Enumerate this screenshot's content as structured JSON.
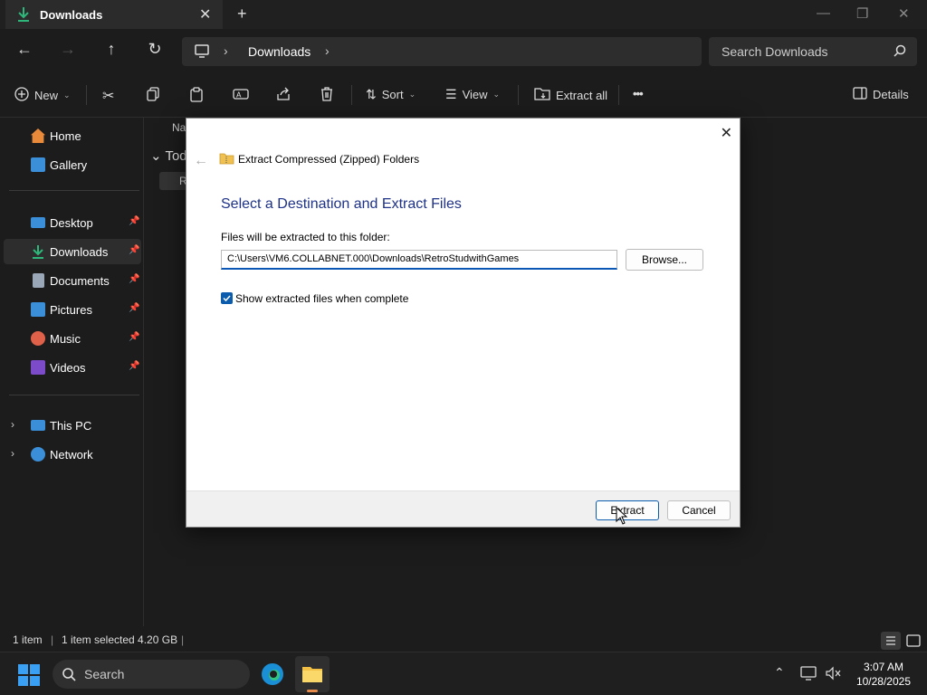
{
  "window": {
    "tab_title": "Downloads",
    "tab_close": "✕",
    "new_tab": "+"
  },
  "address": {
    "crumb": "Downloads",
    "separator": "›",
    "search_placeholder": "Search Downloads"
  },
  "commandbar": {
    "new_label": "New",
    "sort_label": "Sort",
    "view_label": "View",
    "extract_all_label": "Extract all",
    "more_label": "•••",
    "details_label": "Details"
  },
  "sidebar": {
    "items": [
      {
        "label": "Home",
        "icon": "home-icon",
        "color": "#e88a3a"
      },
      {
        "label": "Gallery",
        "icon": "gallery-icon",
        "color": "#3b8fd8"
      },
      {
        "label": "Desktop",
        "icon": "desktop-icon",
        "color": "#3b8fd8",
        "pinned": true
      },
      {
        "label": "Downloads",
        "icon": "download-icon",
        "color": "#2fb67a",
        "pinned": true,
        "selected": true
      },
      {
        "label": "Documents",
        "icon": "documents-icon",
        "color": "#9aa7b8",
        "pinned": true
      },
      {
        "label": "Pictures",
        "icon": "pictures-icon",
        "color": "#3b8fd8",
        "pinned": true
      },
      {
        "label": "Music",
        "icon": "music-icon",
        "color": "#e0614a",
        "pinned": true
      },
      {
        "label": "Videos",
        "icon": "videos-icon",
        "color": "#7b4bc9",
        "pinned": true
      },
      {
        "label": "This PC",
        "icon": "this-pc-icon",
        "color": "#3b8fd8"
      },
      {
        "label": "Network",
        "icon": "network-icon",
        "color": "#3b8fd8"
      }
    ]
  },
  "content": {
    "column_header": "Na",
    "group_label": "Tod",
    "file_partial": "R"
  },
  "status": {
    "count": "1 item",
    "selection": "1 item selected  4.20 GB"
  },
  "dialog": {
    "title": "Extract Compressed (Zipped) Folders",
    "heading": "Select a Destination and Extract Files",
    "path_label": "Files will be extracted to this folder:",
    "path_value": "C:\\Users\\VM6.COLLABNET.000\\Downloads\\RetroStudwithGames",
    "browse_label": "Browse...",
    "checkbox_label": "Show extracted files when complete",
    "checkbox_checked": true,
    "extract_label": "Extract",
    "cancel_label": "Cancel",
    "close": "✕"
  },
  "taskbar": {
    "search_label": "Search",
    "time": "3:07 AM",
    "date": "10/28/2025"
  },
  "colors": {
    "accent": "#0b5cad",
    "dialog_heading": "#1e3287",
    "dark_bg": "#1c1c1c"
  }
}
